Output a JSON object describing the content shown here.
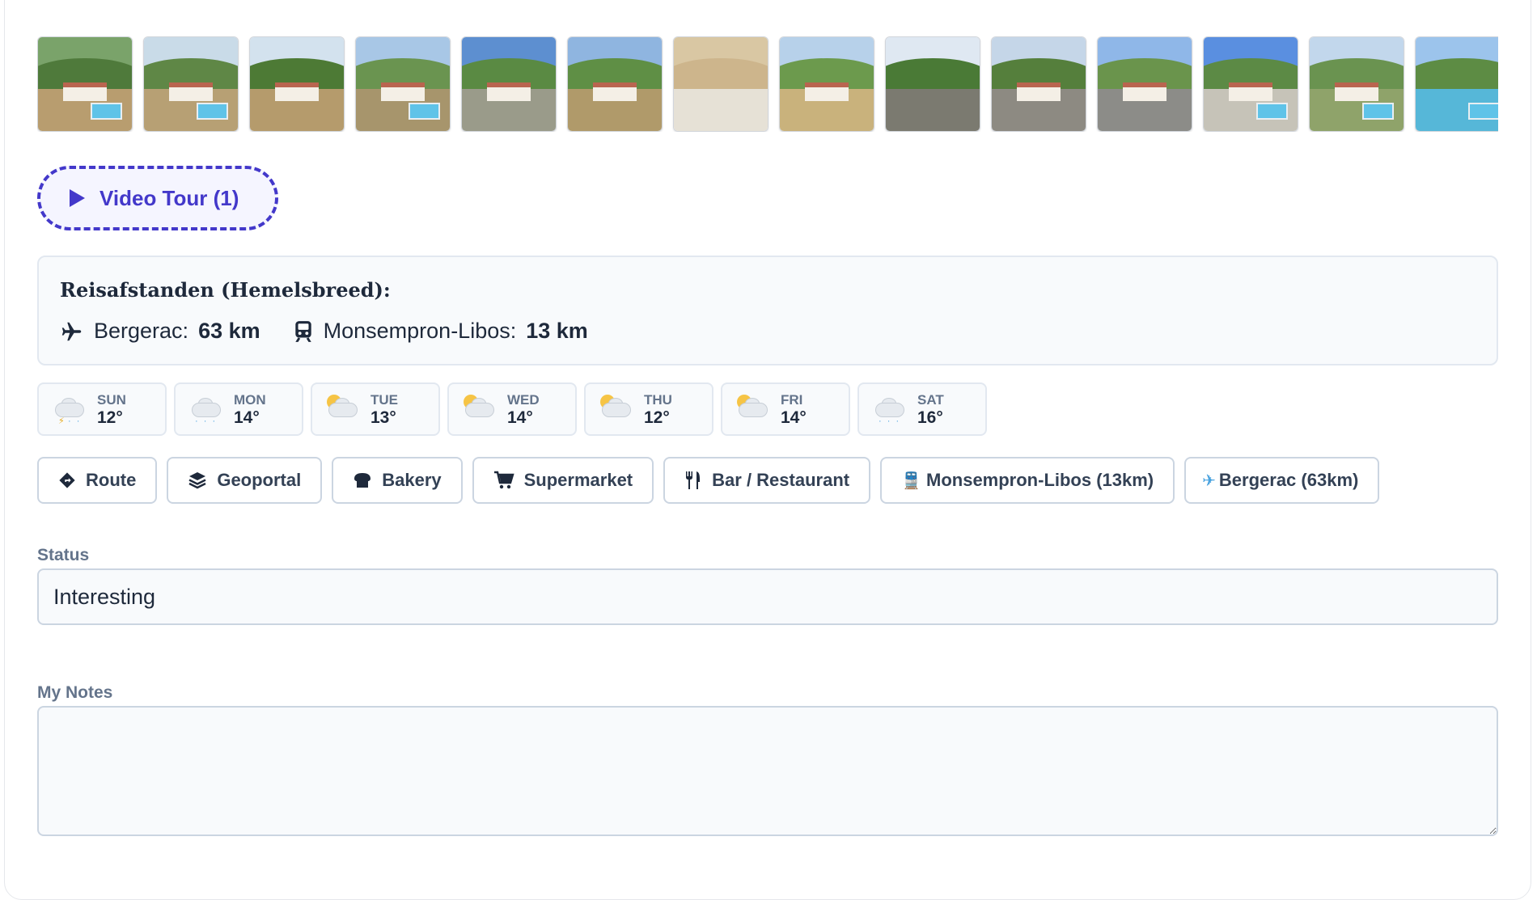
{
  "gallery": {
    "thumbnails": [
      {
        "sky": "#7aa36a",
        "hill": "#4f7a3b",
        "ground": "#b89d6f",
        "house": true,
        "pool": true
      },
      {
        "sky": "#c9dbe8",
        "hill": "#5f8746",
        "ground": "#b7a074",
        "house": true,
        "pool": true
      },
      {
        "sky": "#d3e2ee",
        "hill": "#4d7a35",
        "ground": "#b59b6c",
        "house": true,
        "pool": false
      },
      {
        "sky": "#a8c7e6",
        "hill": "#6a9450",
        "ground": "#a7956c",
        "house": true,
        "pool": true
      },
      {
        "sky": "#5d8fd0",
        "hill": "#5a8a43",
        "ground": "#9a9b8a",
        "house": true,
        "pool": false
      },
      {
        "sky": "#8fb5e0",
        "hill": "#5f8f45",
        "ground": "#b09a6a",
        "house": true,
        "pool": false
      },
      {
        "sky": "#d9c7a3",
        "hill": "#cdb58c",
        "ground": "#e6e1d6",
        "house": false,
        "pool": false
      },
      {
        "sky": "#b7d1ea",
        "hill": "#6c9a4d",
        "ground": "#c9b27c",
        "house": true,
        "pool": false
      },
      {
        "sky": "#dfe8f2",
        "hill": "#4a7a36",
        "ground": "#7b7a70",
        "house": false,
        "pool": false
      },
      {
        "sky": "#c5d6e8",
        "hill": "#557f3c",
        "ground": "#8d8a82",
        "house": true,
        "pool": false
      },
      {
        "sky": "#8fb7e8",
        "hill": "#6a944c",
        "ground": "#8c8c88",
        "house": true,
        "pool": false
      },
      {
        "sky": "#5a8fe0",
        "hill": "#5c8a45",
        "ground": "#c6c3b8",
        "house": true,
        "pool": true
      },
      {
        "sky": "#c2d7ec",
        "hill": "#6a9350",
        "ground": "#8fa36a",
        "house": true,
        "pool": true
      },
      {
        "sky": "#9cc4ec",
        "hill": "#5d8c44",
        "ground": "#56b7d8",
        "house": false,
        "pool": true
      }
    ]
  },
  "video_tour": {
    "label": "Video Tour (1)"
  },
  "distances": {
    "title": "Reisafstanden (Hemelsbreed):",
    "airport": {
      "name": "Bergerac:",
      "value": "63 km"
    },
    "station": {
      "name": "Monsempron-Libos:",
      "value": "13 km"
    }
  },
  "weather": [
    {
      "day": "SUN",
      "temp": "12°",
      "icon": "rain-thunder"
    },
    {
      "day": "MON",
      "temp": "14°",
      "icon": "rain"
    },
    {
      "day": "TUE",
      "temp": "13°",
      "icon": "sun-cloud"
    },
    {
      "day": "WED",
      "temp": "14°",
      "icon": "sun-cloud"
    },
    {
      "day": "THU",
      "temp": "12°",
      "icon": "sun-cloud"
    },
    {
      "day": "FRI",
      "temp": "14°",
      "icon": "sun-cloud"
    },
    {
      "day": "SAT",
      "temp": "16°",
      "icon": "rain"
    }
  ],
  "chips": {
    "route": "Route",
    "geoportal": "Geoportal",
    "bakery": "Bakery",
    "supermarket": "Supermarket",
    "bar": "Bar / Restaurant",
    "station": "Monsempron-Libos (13km)",
    "airport": "Bergerac (63km)"
  },
  "status": {
    "label": "Status",
    "value": "Interesting"
  },
  "notes": {
    "label": "My Notes",
    "value": ""
  },
  "colors": {
    "accent": "#4338ca",
    "text": "#1e293b",
    "muted": "#64748b",
    "border": "#cbd5e1"
  }
}
